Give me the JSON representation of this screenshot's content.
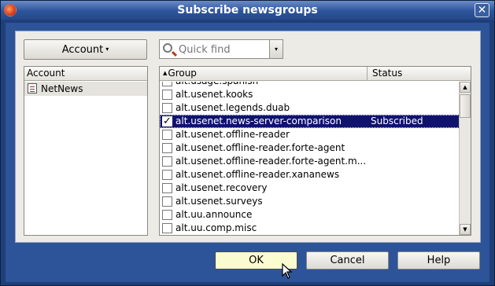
{
  "window": {
    "title": "Subscribe newsgroups",
    "close_label": "✕"
  },
  "toolbar": {
    "account_label": "Account",
    "account_caret": "▾",
    "quickfind_placeholder": "Quick find",
    "quickfind_caret": "▾"
  },
  "account_list": {
    "header": "Account",
    "items": [
      {
        "label": "NetNews"
      }
    ]
  },
  "group_list": {
    "columns": {
      "group": "Group",
      "status": "Status"
    },
    "sort_indicator": "▲",
    "rows": [
      {
        "name": "alt.usage.spanish",
        "status": "",
        "checked": false
      },
      {
        "name": "alt.usenet.kooks",
        "status": "",
        "checked": false
      },
      {
        "name": "alt.usenet.legends.duab",
        "status": "",
        "checked": false
      },
      {
        "name": "alt.usenet.news-server-comparison",
        "status": "Subscribed",
        "checked": true
      },
      {
        "name": "alt.usenet.offline-reader",
        "status": "",
        "checked": false
      },
      {
        "name": "alt.usenet.offline-reader.forte-agent",
        "status": "",
        "checked": false
      },
      {
        "name": "alt.usenet.offline-reader.forte-agent.m...",
        "status": "",
        "checked": false
      },
      {
        "name": "alt.usenet.offline-reader.xananews",
        "status": "",
        "checked": false
      },
      {
        "name": "alt.usenet.recovery",
        "status": "",
        "checked": false
      },
      {
        "name": "alt.usenet.surveys",
        "status": "",
        "checked": false
      },
      {
        "name": "alt.uu.announce",
        "status": "",
        "checked": false
      },
      {
        "name": "alt.uu.comp.misc",
        "status": "",
        "checked": false
      }
    ]
  },
  "buttons": {
    "ok": "OK",
    "cancel": "Cancel",
    "help": "Help"
  }
}
